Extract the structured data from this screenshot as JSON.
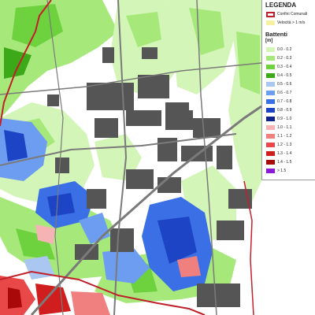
{
  "legend": {
    "title": "LEGENDA",
    "boundary_label": "Confini Comunali",
    "velocity_label": "Velocità > 1 m/s",
    "section_title": "Battenti",
    "unit": "[m]",
    "classes": [
      {
        "label": "0.0 - 0.2",
        "color": "#d4f5b8"
      },
      {
        "label": "0.2 - 0.3",
        "color": "#a6e97a"
      },
      {
        "label": "0.3 - 0.4",
        "color": "#6ed23f"
      },
      {
        "label": "0.4 - 0.5",
        "color": "#3caa18"
      },
      {
        "label": "0.5 - 0.6",
        "color": "#a9c7f0"
      },
      {
        "label": "0.6 - 0.7",
        "color": "#6d9df0"
      },
      {
        "label": "0.7 - 0.8",
        "color": "#3a6fe6"
      },
      {
        "label": "0.8 - 0.9",
        "color": "#1d44c4"
      },
      {
        "label": "0.9 - 1.0",
        "color": "#0e248a"
      },
      {
        "label": "1.0 - 1.1",
        "color": "#f5b3b3"
      },
      {
        "label": "1.1 - 1.2",
        "color": "#f08080"
      },
      {
        "label": "1.2 - 1.3",
        "color": "#e84848"
      },
      {
        "label": "1.3 - 1.4",
        "color": "#d01e1e"
      },
      {
        "label": "1.4 - 1.5",
        "color": "#a80a0a"
      },
      {
        "label": "> 1.5",
        "color": "#8a1ad8"
      }
    ],
    "boundary_color": "#c0202a",
    "velocity_color": "#f7f0a0"
  }
}
